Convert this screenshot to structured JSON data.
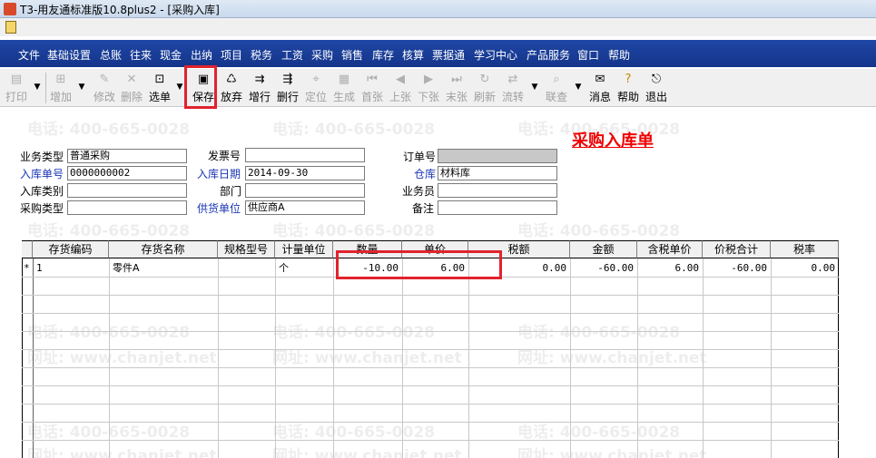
{
  "window": {
    "title": "T3-用友通标准版10.8plus2 - [采购入库]"
  },
  "menu": [
    "文件",
    "基础设置",
    "总账",
    "往来",
    "现金",
    "出纳",
    "项目",
    "税务",
    "工资",
    "采购",
    "销售",
    "库存",
    "核算",
    "票据通",
    "学习中心",
    "产品服务",
    "窗口",
    "帮助"
  ],
  "toolbar": {
    "print": "打印",
    "add": "增加",
    "edit": "修改",
    "delete": "删除",
    "select": "选单",
    "save": "保存",
    "discard": "放弃",
    "add_row": "增行",
    "del_row": "删行",
    "locate": "定位",
    "generate": "生成",
    "first": "首张",
    "prev": "上张",
    "next": "下张",
    "last": "末张",
    "refresh": "刷新",
    "flow": "流转",
    "link": "联查",
    "message": "消息",
    "help": "帮助",
    "exit": "退出"
  },
  "doc_title": "采购入库单",
  "form": {
    "business_type_label": "业务类型",
    "business_type": "普通采购",
    "invoice_no_label": "发票号",
    "invoice_no": "",
    "order_no_label": "订单号",
    "order_no": "",
    "receipt_no_label": "入库单号",
    "receipt_no": "0000000002",
    "receipt_date_label": "入库日期",
    "receipt_date": "2014-09-30",
    "warehouse_label": "仓库",
    "warehouse": "材料库",
    "receipt_category_label": "入库类别",
    "receipt_category": "",
    "department_label": "部门",
    "department": "",
    "salesperson_label": "业务员",
    "salesperson": "",
    "purchase_type_label": "采购类型",
    "purchase_type": "",
    "supplier_label": "供货单位",
    "supplier": "供应商A",
    "remark_label": "备注",
    "remark": ""
  },
  "grid": {
    "columns": [
      "存货编码",
      "存货名称",
      "规格型号",
      "计量单位",
      "数量",
      "单价",
      "税额",
      "金额",
      "含税单价",
      "价税合计",
      "税率"
    ],
    "rows": [
      {
        "marker": "*",
        "code": "1",
        "name": "零件A",
        "spec": "",
        "unit": "个",
        "qty": "-10.00",
        "price": "6.00",
        "tax": "0.00",
        "amount": "-60.00",
        "tax_price": "6.00",
        "total": "-60.00",
        "rate": "0.00"
      }
    ]
  },
  "watermark": {
    "phone": "电话: 400-665-0028",
    "site": "网址: www.chanjet.net"
  },
  "colors": {
    "menubar": "#1f47a5",
    "highlight": "#e0232d",
    "doc_title": "#ee0000",
    "blue_label": "#1a35b5"
  }
}
